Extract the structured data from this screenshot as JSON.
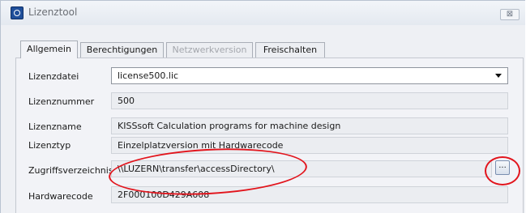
{
  "window": {
    "title": "Lizenztool",
    "close_symbol": "⊠"
  },
  "tabs": [
    {
      "label": "Allgemein",
      "state": "active"
    },
    {
      "label": "Berechtigungen",
      "state": "normal"
    },
    {
      "label": "Netzwerkversion",
      "state": "disabled"
    },
    {
      "label": "Freischalten",
      "state": "normal"
    }
  ],
  "fields": {
    "lizenzdatei": {
      "label": "Lizenzdatei",
      "value": "license500.lic"
    },
    "lizenznummer": {
      "label": "Lizenznummer",
      "value": "500"
    },
    "lizenzname": {
      "label": "Lizenzname",
      "value": "KISSsoft Calculation programs for machine design"
    },
    "lizenztyp": {
      "label": "Lizenztyp",
      "value": "Einzelplatzversion mit Hardwarecode"
    },
    "zugriffsverzeichnis": {
      "label": "Zugriffsverzeichnis",
      "value": "\\\\LUZERN\\transfer\\accessDirectory\\"
    },
    "hardwarecode": {
      "label": "Hardwarecode",
      "value": "2F000100D429A608"
    }
  },
  "browse_button": {
    "label": "..."
  },
  "colors": {
    "annotation": "#e2141c",
    "accent": "#1f4f9a"
  },
  "icons": [
    "app-icon",
    "close-icon",
    "dropdown-arrow-icon"
  ]
}
